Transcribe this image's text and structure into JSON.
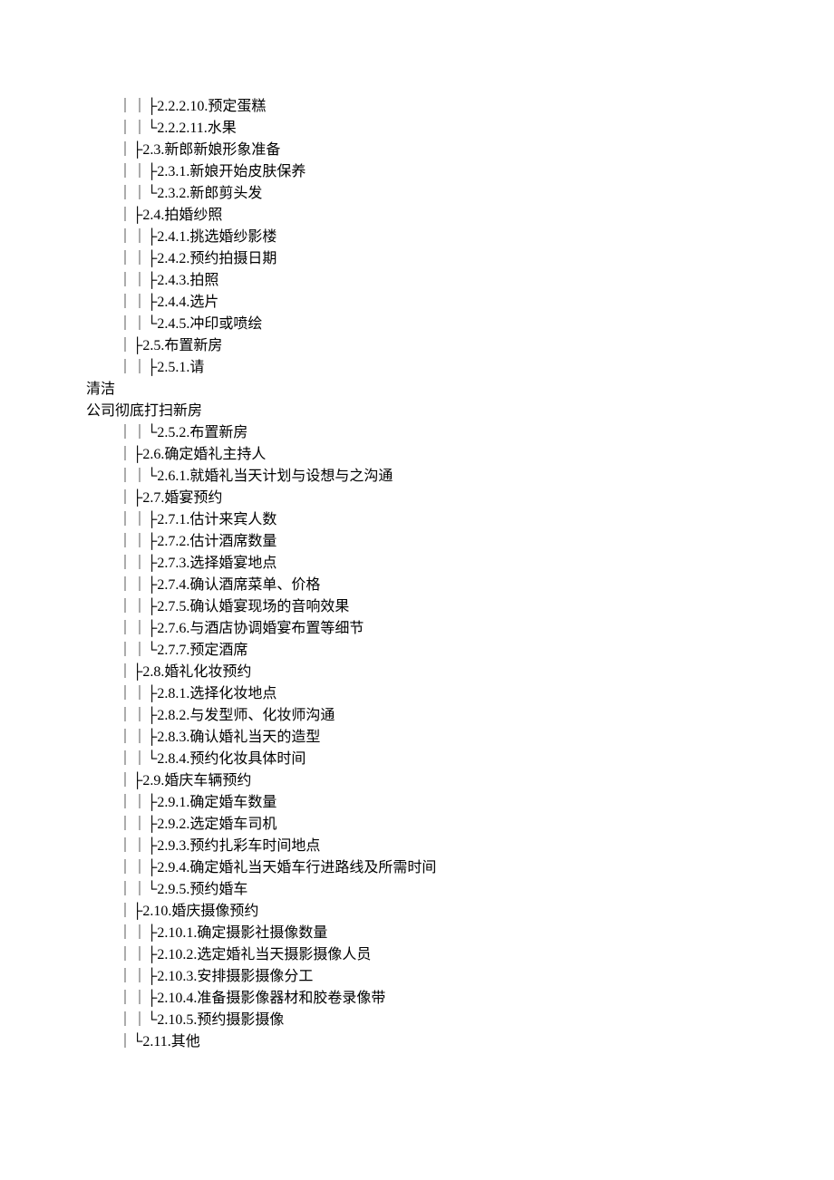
{
  "lines": [
    "｜｜├2.2.2.10.预定蛋糕",
    "｜｜└2.2.2.11.水果",
    "｜├2.3.新郎新娘形象准备",
    "｜｜├2.3.1.新娘开始皮肤保养",
    "｜｜└2.3.2.新郎剪头发",
    "｜├2.4.拍婚纱照",
    "｜｜├2.4.1.挑选婚纱影楼",
    "｜｜├2.4.2.预约拍摄日期",
    "｜｜├2.4.3.拍照",
    "｜｜├2.4.4.选片",
    "｜｜└2.4.5.冲印或喷绘",
    "｜├2.5.布置新房",
    "｜｜├2.5.1.请",
    "清洁",
    "公司彻底打扫新房",
    "｜｜└2.5.2.布置新房",
    "｜├2.6.确定婚礼主持人",
    "｜｜└2.6.1.就婚礼当天计划与设想与之沟通",
    "｜├2.7.婚宴预约",
    "｜｜├2.7.1.估计来宾人数",
    "｜｜├2.7.2.估计酒席数量",
    "｜｜├2.7.3.选择婚宴地点",
    "｜｜├2.7.4.确认酒席菜单、价格",
    "｜｜├2.7.5.确认婚宴现场的音响效果",
    "｜｜├2.7.6.与酒店协调婚宴布置等细节",
    "｜｜└2.7.7.预定酒席",
    "｜├2.8.婚礼化妆预约",
    "｜｜├2.8.1.选择化妆地点",
    "｜｜├2.8.2.与发型师、化妆师沟通",
    "｜｜├2.8.3.确认婚礼当天的造型",
    "｜｜└2.8.4.预约化妆具体时间",
    "｜├2.9.婚庆车辆预约",
    "｜｜├2.9.1.确定婚车数量",
    "｜｜├2.9.2.选定婚车司机",
    "｜｜├2.9.3.预约扎彩车时间地点",
    "｜｜├2.9.4.确定婚礼当天婚车行进路线及所需时间",
    "｜｜└2.9.5.预约婚车",
    "｜├2.10.婚庆摄像预约",
    "｜｜├2.10.1.确定摄影社摄像数量",
    "｜｜├2.10.2.选定婚礼当天摄影摄像人员",
    "｜｜├2.10.3.安排摄影摄像分工",
    "｜｜├2.10.4.准备摄影像器材和胶卷录像带",
    "｜｜└2.10.5.预约摄影摄像",
    "｜└2.11.其他"
  ]
}
